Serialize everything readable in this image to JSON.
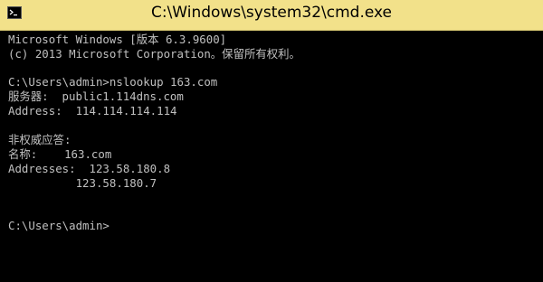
{
  "window": {
    "title": "C:\\Windows\\system32\\cmd.exe",
    "titlebar_color": "#f2e18a",
    "console_bg": "#000000",
    "console_fg": "#c0c0c0"
  },
  "console": {
    "lines": [
      "Microsoft Windows [版本 6.3.9600]",
      "(c) 2013 Microsoft Corporation。保留所有权利。",
      "",
      "C:\\Users\\admin>nslookup 163.com",
      "服务器:  public1.114dns.com",
      "Address:  114.114.114.114",
      "",
      "非权威应答:",
      "名称:    163.com",
      "Addresses:  123.58.180.8",
      "          123.58.180.7",
      "",
      "",
      "C:\\Users\\admin>"
    ]
  }
}
